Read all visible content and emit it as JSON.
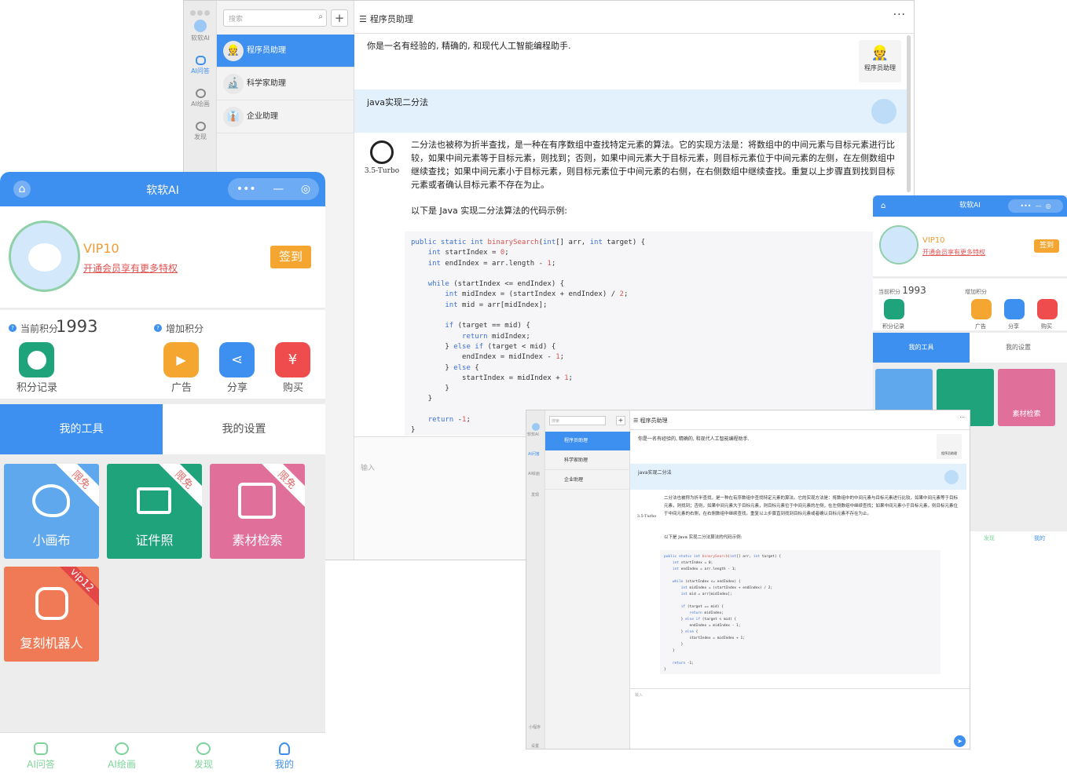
{
  "main": {
    "rail": [
      {
        "label": "软软AI"
      },
      {
        "label": "AI问答"
      },
      {
        "label": "AI绘画"
      },
      {
        "label": "发现"
      }
    ],
    "search_placeholder": "搜索",
    "add": "+",
    "conversations": [
      {
        "name": "程序员助理",
        "icon": "👷"
      },
      {
        "name": "科学家助理",
        "icon": "🔬"
      },
      {
        "name": "企业助理",
        "icon": "👔"
      }
    ],
    "header_title": "程序员助理",
    "more": "···",
    "system_msg": "你是一名有经验的, 精确的, 和现代人工智能编程助手.",
    "system_avatar_label": "程序员助理",
    "user_msg": "java实现二分法",
    "model_label": "3.5-Turbo",
    "answer_p1": "二分法也被称为折半查找，是一种在有序数组中查找特定元素的算法。它的实现方法是：将数组中的中间元素与目标元素进行比较，如果中间元素等于目标元素，则找到；否则，如果中间元素大于目标元素，则目标元素位于中间元素的左侧，在左侧数组中继续查找；如果中间元素小于目标元素，则目标元素位于中间元素的右侧，在右侧数组中继续查找。重复以上步骤直到找到目标元素或者确认目标元素不存在为止。",
    "answer_p2": "以下是 Java 实现二分法算法的代码示例:",
    "input_placeholder": "输入"
  },
  "phone": {
    "title": "软软AI",
    "capsule_dots": "•••",
    "capsule_minus": "—",
    "capsule_circle": "◎",
    "vip_level": "VIP10",
    "vip_link": "开通会员享有更多特权",
    "sign_in": "签到",
    "points_label": "当前积分",
    "points_value": "1993",
    "earn_label": "增加积分",
    "points_record": "积分记录",
    "ad": "广告",
    "share": "分享",
    "buy": "购买",
    "tab_tools": "我的工具",
    "tab_settings": "我的设置",
    "tiles": [
      {
        "label": "小画布",
        "badge": "限免"
      },
      {
        "label": "证件照",
        "badge": "限免"
      },
      {
        "label": "素材检索",
        "badge": "限免"
      },
      {
        "label": "复刻机器人",
        "badge": "vip12"
      }
    ],
    "bottom_tabs": [
      "AI问答",
      "AI绘画",
      "发现",
      "我的"
    ]
  },
  "small_window": {
    "side_bottom": [
      "小程序",
      "设置"
    ]
  },
  "colors": {
    "brand_blue": "#3d8ff0",
    "orange": "#f4a630",
    "green": "#1fa37a",
    "pink": "#e0709a",
    "coral": "#ef7a55"
  }
}
